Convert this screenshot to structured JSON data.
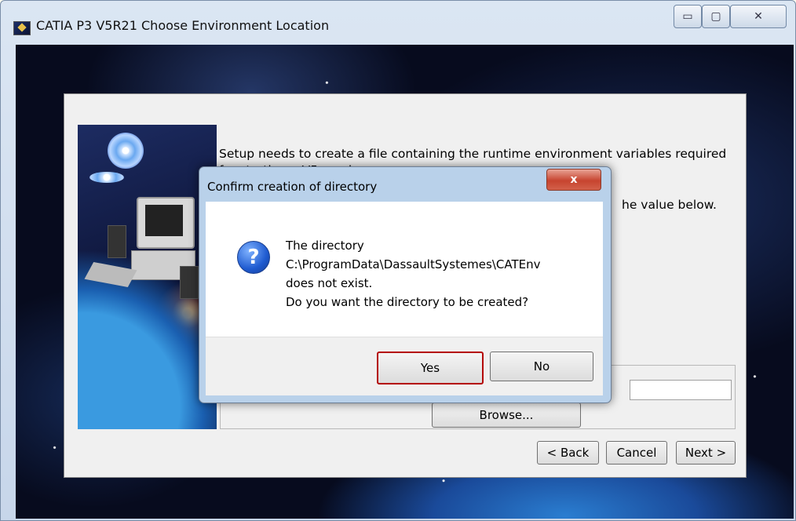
{
  "window": {
    "title": "CATIA P3 V5R21 Choose Environment Location",
    "controls": {
      "minimize": "▭",
      "maximize": "▢",
      "close": "✕"
    }
  },
  "setup": {
    "text_line1": "Setup needs to create a file containing the runtime environment variables required for starting a V5 session.",
    "text_line2": "he value below.",
    "path_value": "",
    "browse_label": "Browse...",
    "back_label": "< Back",
    "cancel_label": "Cancel",
    "next_label": "Next >"
  },
  "dialog": {
    "title": "Confirm creation of directory",
    "close_label": "x",
    "icon": "question-icon",
    "message": [
      "The directory",
      "C:\\ProgramData\\DassaultSystemes\\CATEnv",
      "does not exist.",
      "Do you want the directory to be created?"
    ],
    "yes_label": "Yes",
    "no_label": "No"
  },
  "colors": {
    "highlight_border": "#b40000",
    "dialog_frame": "#b9d1ea"
  }
}
